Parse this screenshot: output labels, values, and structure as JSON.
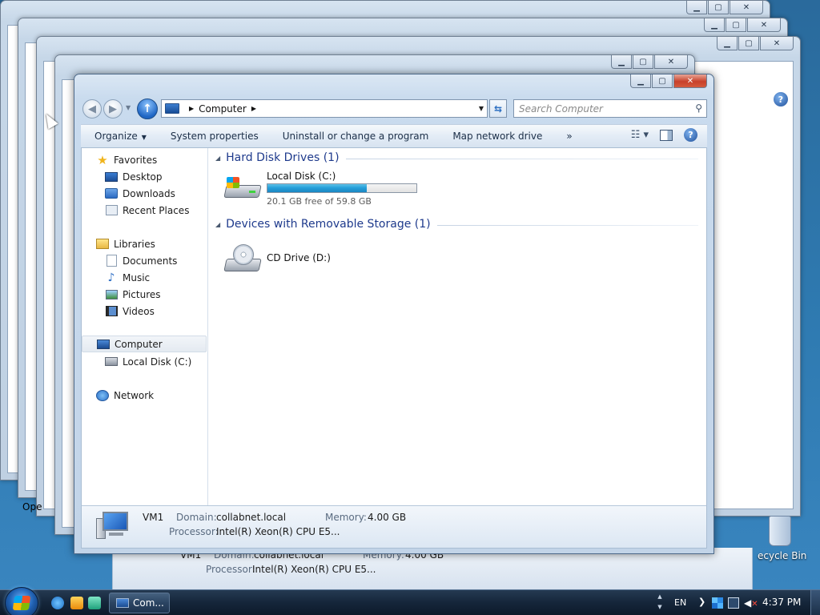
{
  "window": {
    "address_crumb": "Computer",
    "search_placeholder": "Search Computer"
  },
  "commandbar": {
    "organize": "Organize",
    "system_properties": "System properties",
    "uninstall": "Uninstall or change a program",
    "map_drive": "Map network drive",
    "more": "»"
  },
  "navpane": {
    "favorites": "Favorites",
    "desktop": "Desktop",
    "downloads": "Downloads",
    "recent": "Recent Places",
    "libraries": "Libraries",
    "documents": "Documents",
    "music": "Music",
    "pictures": "Pictures",
    "videos": "Videos",
    "computer": "Computer",
    "local_disk": "Local Disk (C:)",
    "network": "Network"
  },
  "groups": {
    "hdd_title": "Hard Disk Drives (1)",
    "removable_title": "Devices with Removable Storage (1)"
  },
  "drives": {
    "c_name": "Local Disk (C:)",
    "c_free": "20.1 GB free of 59.8 GB",
    "c_used_fraction": 0.664,
    "d_name": "CD Drive (D:)"
  },
  "details": {
    "name": "VM1",
    "domain_label": "Domain:",
    "domain_value": "collabnet.local",
    "memory_label": "Memory:",
    "memory_value": "4.00 GB",
    "processor_label": "Processor:",
    "processor_value": "Intel(R) Xeon(R) CPU E5..."
  },
  "desktop": {
    "recycle_label": "ecycle Bin",
    "partial_text": "Ope"
  },
  "taskbar": {
    "task_label": "Com...",
    "lang": "EN",
    "clock": "4:37 PM"
  }
}
